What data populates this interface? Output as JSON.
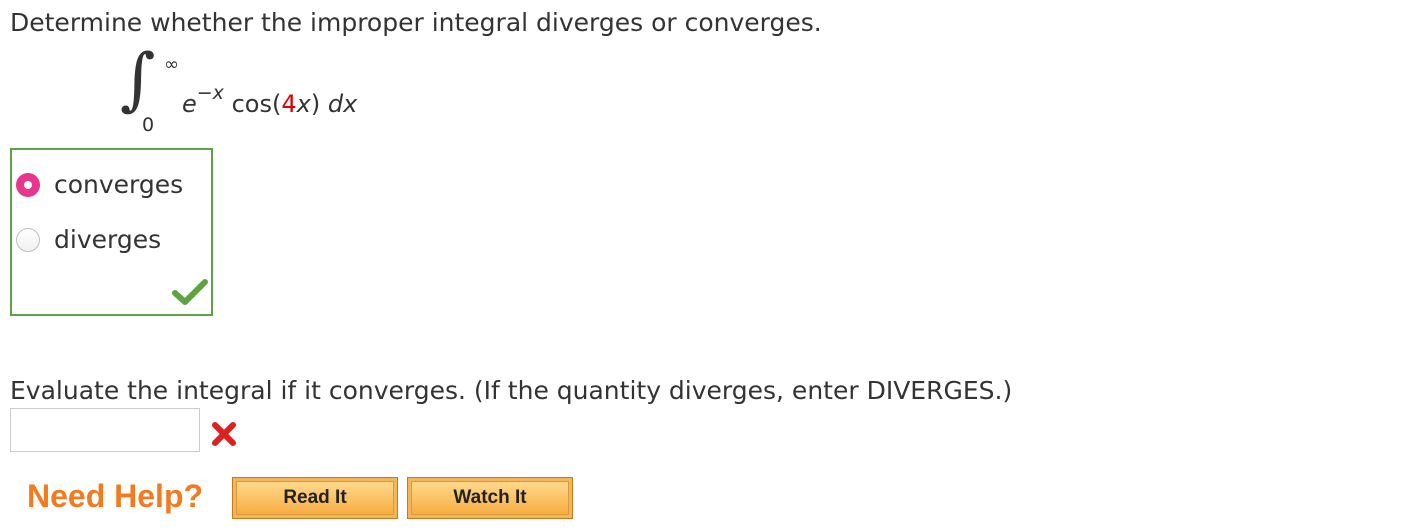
{
  "question": {
    "prompt": "Determine whether the improper integral diverges or converges."
  },
  "integral": {
    "sign": "∫",
    "upper_limit": "∞",
    "lower_limit": "0",
    "base": "e",
    "exponent": "−x",
    "func_open": "cos(",
    "coefficient": "4",
    "arg_var": "x",
    "func_close": ")",
    "differential": "dx"
  },
  "choices": {
    "options": [
      {
        "label": "converges",
        "selected": true
      },
      {
        "label": "diverges",
        "selected": false
      }
    ],
    "result_icon": "check-icon",
    "result_color": "#5ea241"
  },
  "evaluate": {
    "prompt": "Evaluate the integral if it converges. (If the quantity diverges, enter DIVERGES.)",
    "input_value": "",
    "result_icon": "x-icon",
    "result_color": "#e02020"
  },
  "help": {
    "label": "Need Help?",
    "read_label": "Read It",
    "watch_label": "Watch It"
  },
  "colors": {
    "accent_orange": "#f47a20",
    "radio_selected": "#e8358e",
    "coefficient_red": "#e00000",
    "correct_border": "#5ea241"
  }
}
